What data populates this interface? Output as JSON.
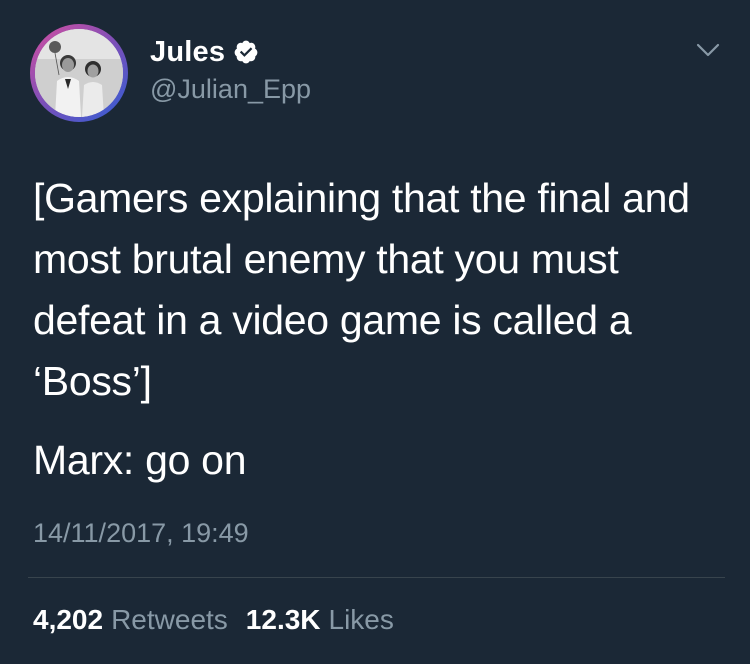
{
  "user": {
    "display_name": "Jules",
    "handle": "@Julian_Epp",
    "verified": true
  },
  "tweet": {
    "paragraphs": [
      "[Gamers explaining that the final and most brutal enemy that you must defeat in a video game is called a ‘Boss’]",
      "Marx: go on"
    ],
    "timestamp": "14/11/2017, 19:49"
  },
  "stats": {
    "retweets_count": "4,202",
    "retweets_label": "Retweets",
    "likes_count": "12.3K",
    "likes_label": "Likes"
  },
  "colors": {
    "background": "#1b2836",
    "text": "#ffffff",
    "muted": "#8899a6",
    "divider": "#38444d",
    "verified": "#ffffff"
  },
  "icons": {
    "verified": "verified-badge-icon",
    "menu": "chevron-down-icon"
  }
}
